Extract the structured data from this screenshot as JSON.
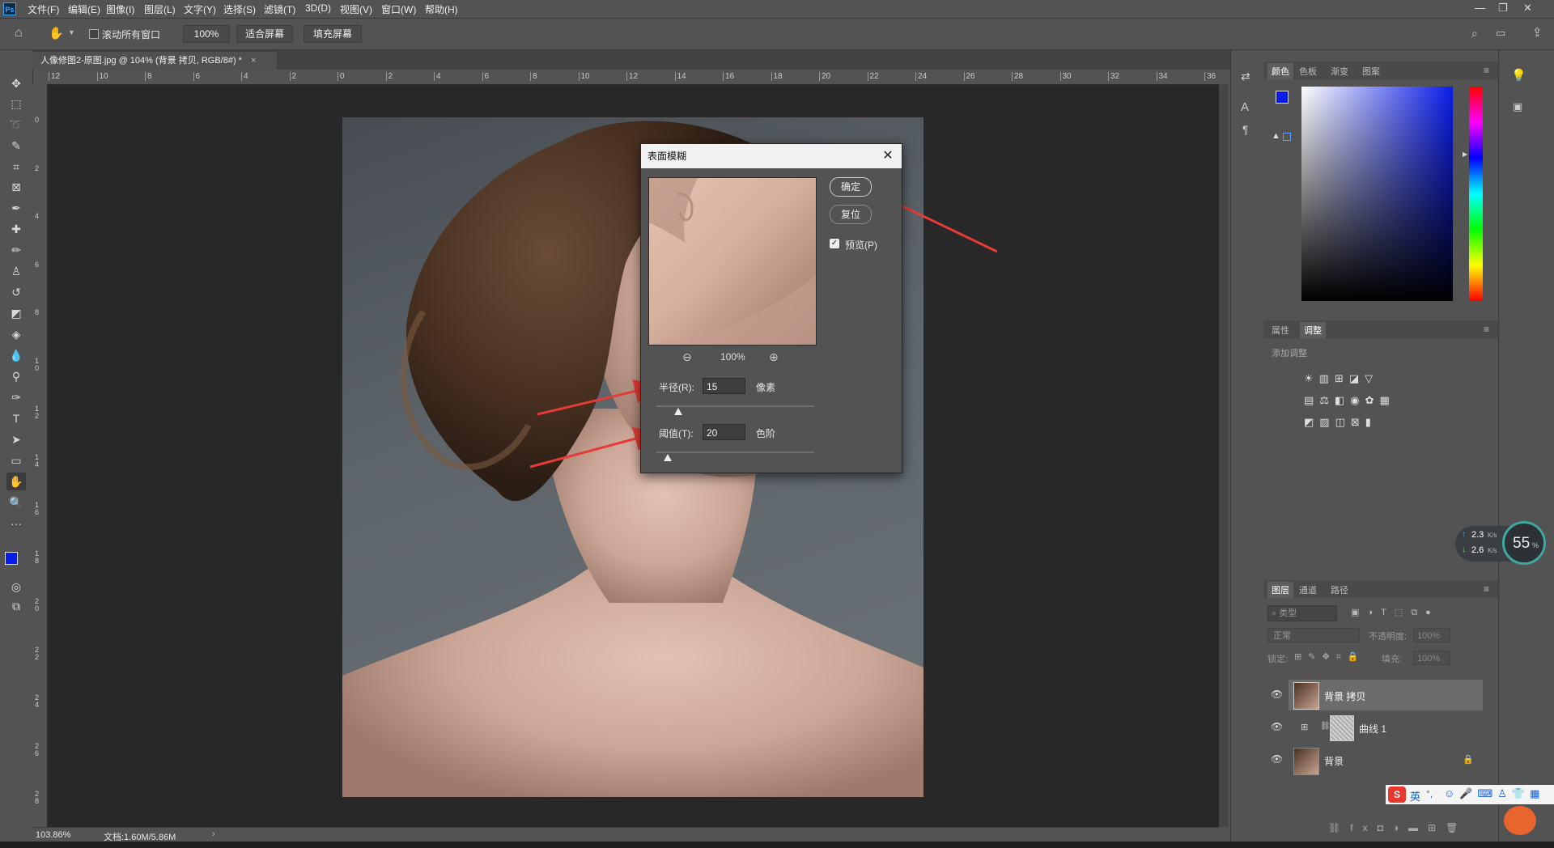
{
  "app": {
    "logo": "Ps"
  },
  "menu": [
    "文件(F)",
    "编辑(E)",
    "图像(I)",
    "图层(L)",
    "文字(Y)",
    "选择(S)",
    "滤镜(T)",
    "3D(D)",
    "视图(V)",
    "窗口(W)",
    "帮助(H)"
  ],
  "options": {
    "scroll_all": "滚动所有窗口",
    "zoom": "100%",
    "fit_screen": "适合屏幕",
    "fill_screen": "填充屏幕"
  },
  "document": {
    "tab_title": "人像修图2-原图.jpg @ 104% (背景 拷贝, RGB/8#) *",
    "zoom_status": "103.86%",
    "doc_status": "文档:1.60M/5.86M"
  },
  "ruler": {
    "h_labels": [
      "12",
      "10",
      "8",
      "6",
      "4",
      "2",
      "0",
      "2",
      "4",
      "6",
      "8",
      "10",
      "12",
      "14",
      "16",
      "18",
      "20",
      "22",
      "24",
      "26",
      "28",
      "30",
      "32",
      "34",
      "36"
    ],
    "v_labels": [
      "0",
      "2",
      "4",
      "6",
      "8",
      "10",
      "12",
      "14",
      "16",
      "18",
      "20",
      "22",
      "24",
      "26",
      "28"
    ]
  },
  "dialog": {
    "title": "表面模糊",
    "ok": "确定",
    "reset": "复位",
    "preview_label": "预览(P)",
    "preview_checked": true,
    "zoom": "100%",
    "radius_label": "半径(R):",
    "radius_value": "15",
    "radius_unit": "像素",
    "radius_fraction": 0.14,
    "threshold_label": "阈值(T):",
    "threshold_value": "20",
    "threshold_unit": "色阶",
    "threshold_fraction": 0.07
  },
  "panels": {
    "color_tabs": [
      "颜色",
      "色板",
      "渐变",
      "图案"
    ],
    "adj_tabs": [
      "属性",
      "调整"
    ],
    "adj_hint": "添加调整",
    "layer_tabs": [
      "图层",
      "通道",
      "路径"
    ],
    "layer_filter": "类型",
    "blend_mode": "正常",
    "opacity_label": "不透明度:",
    "opacity_value": "100%",
    "lock_label": "锁定:",
    "fill_label": "填充:",
    "fill_value": "100%",
    "layers": [
      {
        "name": "背景 拷贝"
      },
      {
        "name": "曲线 1"
      },
      {
        "name": "背景"
      }
    ]
  },
  "widget": {
    "up_speed": "2.3",
    "down_speed": "2.6",
    "speed_unit": "K/s",
    "percent": "55",
    "percent_unit": "%"
  },
  "ime": {
    "lang": "英",
    "symbols": "°,"
  },
  "colors": {
    "foreground": "#0a1de8",
    "accent_arrow": "#e63b36"
  }
}
